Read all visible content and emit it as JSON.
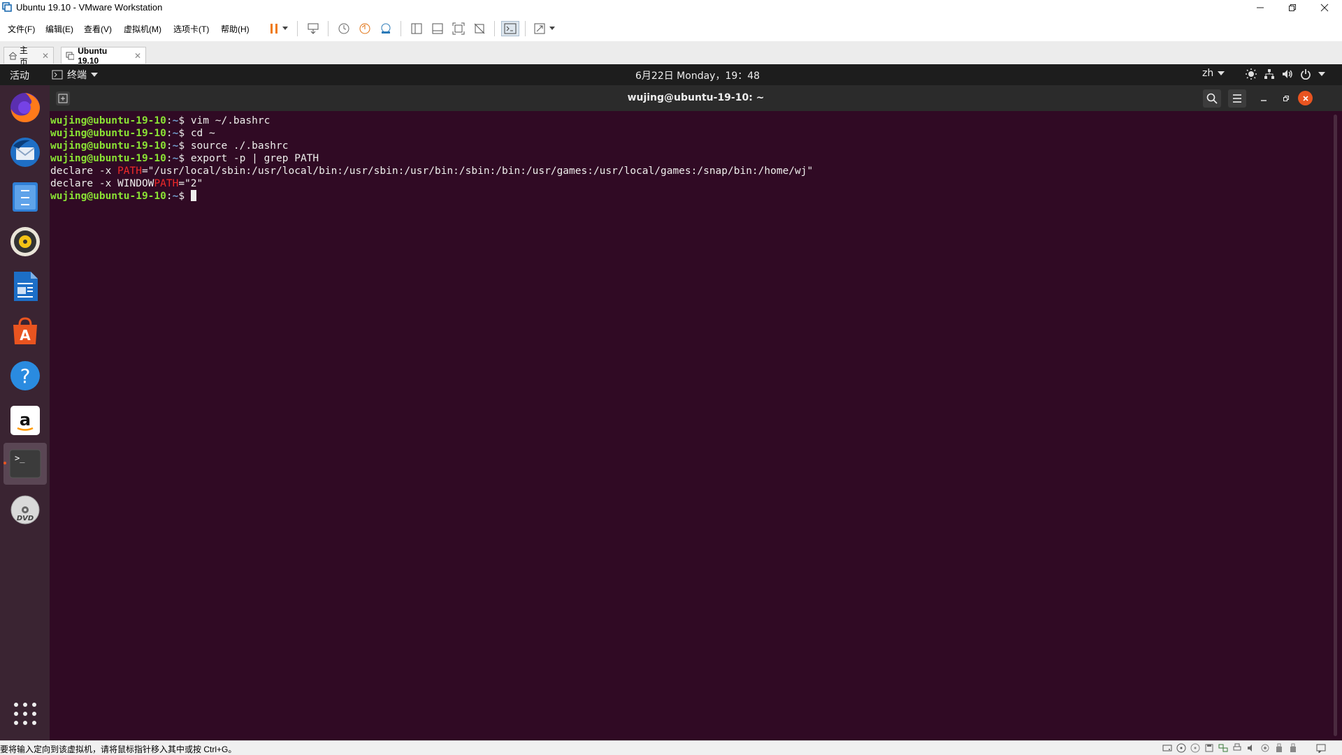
{
  "window": {
    "title": "Ubuntu 19.10 - VMware Workstation"
  },
  "menubar": {
    "items": [
      "文件(F)",
      "编辑(E)",
      "查看(V)",
      "虚拟机(M)",
      "选项卡(T)",
      "帮助(H)"
    ]
  },
  "tabs": [
    {
      "label": "主页",
      "active": false
    },
    {
      "label": "Ubuntu 19.10",
      "active": true
    }
  ],
  "gnome": {
    "activities": "活动",
    "app_menu": "终端",
    "clock": "6月22日 Monday，19：48",
    "input_method": "zh"
  },
  "dock": {
    "apps": [
      "firefox-icon",
      "thunderbird-icon",
      "files-icon",
      "rhythmbox-icon",
      "libreoffice-writer-icon",
      "software-center-icon",
      "help-icon",
      "amazon-icon",
      "terminal-icon",
      "dvd-icon"
    ],
    "show_apps": "show-applications-icon"
  },
  "terminal": {
    "title": "wujing@ubuntu-19-10: ~",
    "prompt_user": "wujing@ubuntu-19-10",
    "prompt_path": "~",
    "lines": [
      {
        "kind": "cmd",
        "text": "vim ~/.bashrc"
      },
      {
        "kind": "cmd",
        "text": "cd ~"
      },
      {
        "kind": "cmd",
        "text": "source ./.bashrc"
      },
      {
        "kind": "cmd",
        "text": "export -p | grep PATH"
      },
      {
        "kind": "out",
        "before": "declare -x ",
        "match": "PATH",
        "after": "=\"/usr/local/sbin:/usr/local/bin:/usr/sbin:/usr/bin:/sbin:/bin:/usr/games:/usr/local/games:/snap/bin:/home/wj\""
      },
      {
        "kind": "out",
        "before": "declare -x WINDOW",
        "match": "PATH",
        "after": "=\"2\""
      },
      {
        "kind": "cmd",
        "text": ""
      }
    ]
  },
  "statusbar": {
    "message": "要将输入定向到该虚拟机，请将鼠标指针移入其中或按 Ctrl+G。"
  },
  "colors": {
    "terminal_bg": "#300a24",
    "prompt_user": "#8ae234",
    "prompt_path": "#729fcf",
    "grep_match": "#ef2929",
    "close_button": "#e95420"
  }
}
